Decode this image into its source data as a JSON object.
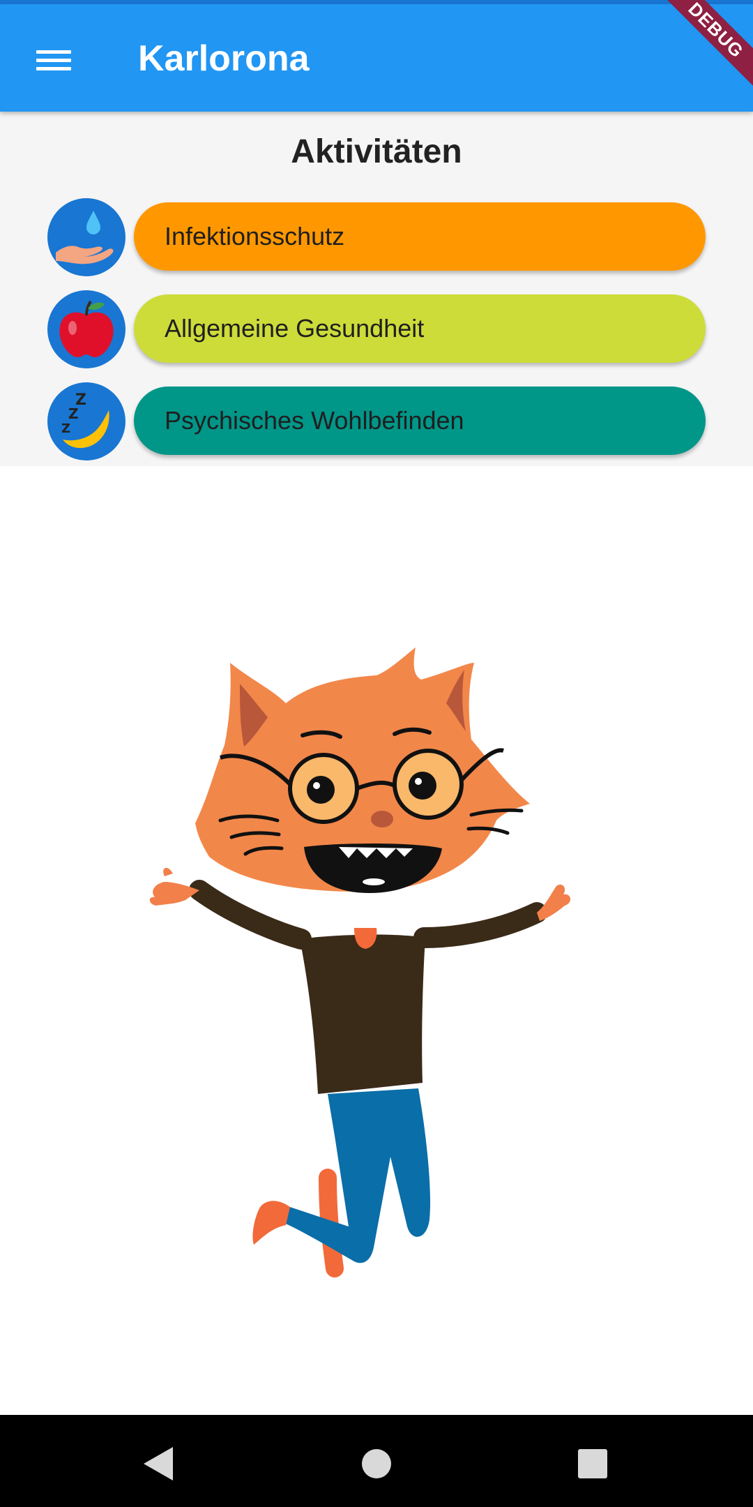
{
  "app": {
    "title": "Karlorona",
    "debug_banner": "DEBUG"
  },
  "section": {
    "title": "Aktivitäten"
  },
  "activities": [
    {
      "label": "Infektionsschutz",
      "color": "#FF9800",
      "icon": "hand-water-drop-icon"
    },
    {
      "label": "Allgemeine Gesundheit",
      "color": "#CDDC39",
      "icon": "apple-icon"
    },
    {
      "label": "Psychisches Wohlbefinden",
      "color": "#009688",
      "icon": "sleeping-moon-icon"
    }
  ],
  "colors": {
    "appbar": "#2196F3",
    "icon_circle": "#1976D2",
    "body_background": "#F5F5F5"
  },
  "illustration": {
    "icon": "cat-mascot-illustration"
  },
  "navigation": {
    "icons": [
      "back-icon",
      "home-icon",
      "recents-icon"
    ]
  }
}
